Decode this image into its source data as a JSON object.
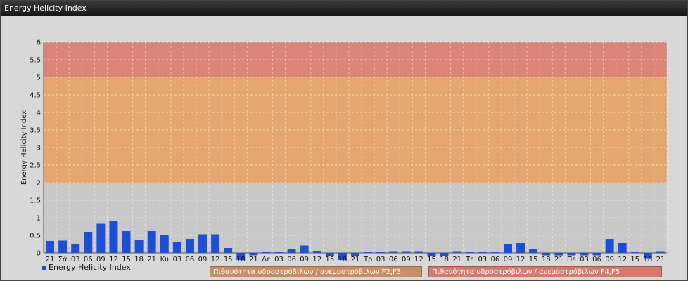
{
  "window": {
    "title": "Energy Helicity Index"
  },
  "legend": {
    "series_label": "Energy Helicity Index"
  },
  "zones": {
    "f2f3": "Πιθανότητα υδροστρόβιλων / ανεμοστρόβιλων F2,F3",
    "f4f5": "Πιθανότητα υδροστρόβιλων / ανεμοστρόβιλων F4,F5"
  },
  "colors": {
    "bar": "#1a4fd6",
    "band_low": "#e7a15e",
    "band_high": "#e1786b",
    "plot_bg": "#c8c8c8"
  },
  "chart_data": {
    "type": "bar",
    "ylabel": "Energy Helicity Index",
    "ylim": [
      0,
      6
    ],
    "yticks": [
      "0",
      "0.5",
      "1",
      "1.5",
      "2",
      "2.5",
      "3",
      "3.5",
      "4",
      "4.5",
      "5",
      "5.5",
      "6"
    ],
    "grid": true,
    "bands": [
      {
        "from": 2,
        "to": 5,
        "label_key": "f2f3"
      },
      {
        "from": 5,
        "to": 6,
        "label_key": "f4f5"
      }
    ],
    "categories": [
      "21",
      "Σά",
      "03",
      "06",
      "09",
      "12",
      "15",
      "18",
      "21",
      "Κυ",
      "03",
      "06",
      "09",
      "12",
      "15",
      "18",
      "21",
      "Δε",
      "03",
      "06",
      "09",
      "12",
      "15",
      "18",
      "21",
      "Τρ",
      "03",
      "06",
      "09",
      "12",
      "15",
      "18",
      "21",
      "Τε",
      "03",
      "06",
      "09",
      "12",
      "15",
      "18",
      "21",
      "Πε",
      "03",
      "06",
      "09",
      "12",
      "15",
      "18",
      "21"
    ],
    "values": [
      0.34,
      0.35,
      0.26,
      0.6,
      0.83,
      0.91,
      0.62,
      0.37,
      0.62,
      0.52,
      0.31,
      0.4,
      0.53,
      0.53,
      0.14,
      -0.2,
      -0.07,
      0.02,
      0.02,
      0.1,
      0.21,
      0.04,
      -0.09,
      -0.2,
      -0.1,
      0.02,
      0.02,
      0.03,
      0.03,
      0.03,
      -0.1,
      -0.1,
      0.03,
      0.02,
      0.02,
      0.02,
      0.25,
      0.28,
      0.1,
      -0.07,
      -0.07,
      -0.07,
      -0.07,
      -0.07,
      0.4,
      0.28,
      0.02,
      -0.15,
      0.03
    ]
  }
}
